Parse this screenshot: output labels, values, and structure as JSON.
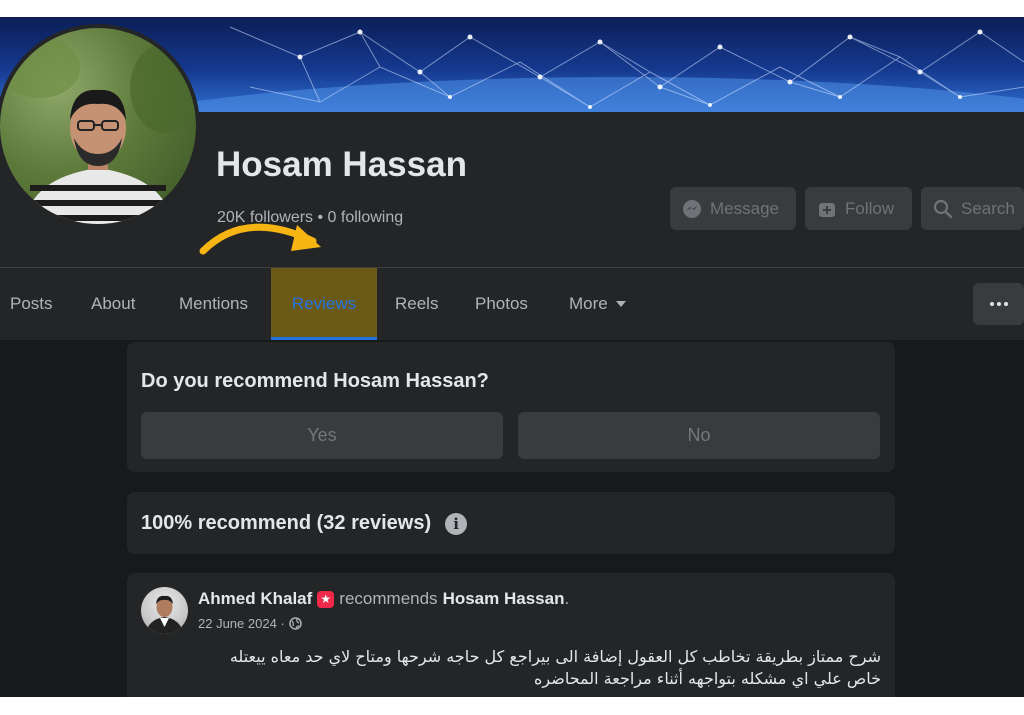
{
  "profile": {
    "name": "Hosam Hassan",
    "stats": "20K followers • 0 following"
  },
  "actions": {
    "message": "Message",
    "follow": "Follow",
    "search": "Search"
  },
  "tabs": [
    {
      "label": "Posts"
    },
    {
      "label": "About"
    },
    {
      "label": "Mentions"
    },
    {
      "label": "Reviews",
      "active": true
    },
    {
      "label": "Reels"
    },
    {
      "label": "Photos"
    },
    {
      "label": "More"
    }
  ],
  "recommend": {
    "question": "Do you recommend Hosam Hassan?",
    "yes": "Yes",
    "no": "No"
  },
  "summary": {
    "text": "100% recommend (32 reviews)",
    "info": "i"
  },
  "review": {
    "author": "Ahmed Khalaf",
    "verb": "recommends",
    "target": "Hosam Hassan",
    "period": ".",
    "date": "22 June 2024 ·",
    "text_line1": "شرح ممتاز بطريقة تخاطب كل العقول إضافة الى بيراجع كل حاجه شرحها ومتاح لاي حد معاه ييعتله",
    "text_line2": "خاص علي اي مشكله بتواجهه أثناء مراجعة المحاضره"
  },
  "icons": [
    "messenger-icon",
    "follow-icon",
    "search-icon",
    "caret-down-icon",
    "more-dots-icon",
    "info-icon",
    "star-badge-icon",
    "globe-icon",
    "arrow-annotation-icon"
  ],
  "colors": {
    "background": "#18191a",
    "surface": "#242526",
    "button": "#3a3b3c",
    "text_primary": "#e4e6eb",
    "text_secondary": "#b0b3b8",
    "accent": "#2374e1",
    "highlight": "#6b5a17",
    "arrow": "#f7b514"
  }
}
